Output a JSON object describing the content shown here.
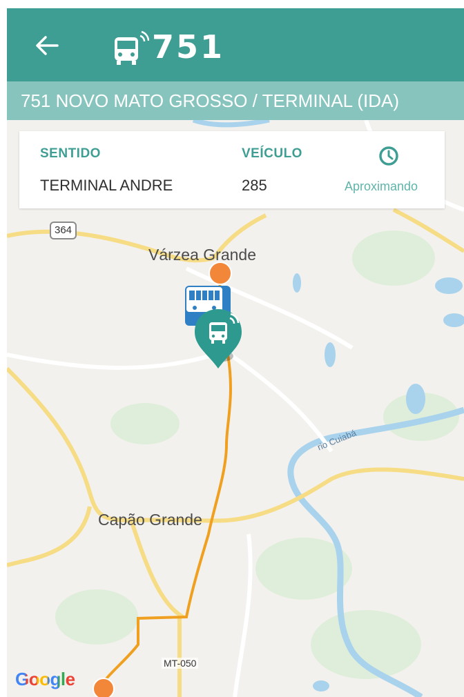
{
  "header": {
    "back_icon": "arrow-back-icon",
    "bus_icon": "bus-wifi-icon",
    "route_number": "751",
    "background_color": "#3f9e93"
  },
  "subtitle": {
    "text": "751 NOVO MATO GROSSO / TERMINAL (IDA)",
    "background_color": "#86c4bd"
  },
  "info_card": {
    "direction_label": "SENTIDO",
    "direction_value": "TERMINAL ANDRE",
    "vehicle_label": "VEÍCULO",
    "vehicle_value": "285",
    "status_icon": "clock-icon",
    "status_text": "Aproximando"
  },
  "map": {
    "place_labels": {
      "varzea_grande": "Várzea Grande",
      "capao_grande": "Capão Grande",
      "river": "rio Cuiabá"
    },
    "road_shields": {
      "br364": "364",
      "mt050": "MT-050"
    },
    "attribution": "Google",
    "markers": {
      "stop_marker_icon": "bus-stop-icon",
      "vehicle_marker_icon": "bus-location-pin-icon",
      "route_color": "#f0a020",
      "stop_color": "#f2873a"
    }
  }
}
